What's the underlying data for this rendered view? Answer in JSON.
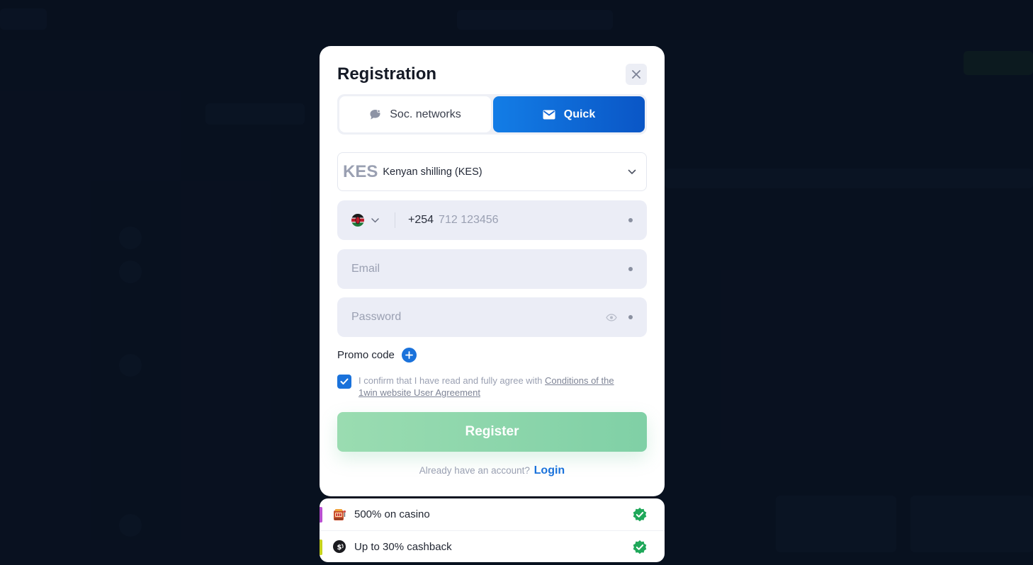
{
  "modal": {
    "title": "Registration",
    "tabs": [
      {
        "label": "Soc. networks",
        "icon": "chat-bubble-icon",
        "active": false
      },
      {
        "label": "Quick",
        "icon": "envelope-icon",
        "active": true
      }
    ],
    "currency": {
      "code": "KES",
      "name": "Kenyan shilling (KES)"
    },
    "phone": {
      "country_flag": "kenya-flag-icon",
      "prefix": "+254",
      "placeholder": "712 123456"
    },
    "email": {
      "placeholder": "Email"
    },
    "password": {
      "placeholder": "Password"
    },
    "promo_label": "Promo code",
    "agreement": {
      "text": "I confirm that I have read and fully agree with ",
      "link": "Conditions of the 1win website User Agreement",
      "checked": true
    },
    "register_label": "Register",
    "login_prompt": "Already have an account?",
    "login_link": "Login"
  },
  "bonuses": [
    {
      "label": "500% on casino",
      "icon": "slot-machine-icon",
      "accent": "#b84fd0"
    },
    {
      "label": "Up to 30% cashback",
      "icon": "cashback-coin-icon",
      "accent": "#c6d21a"
    }
  ],
  "colors": {
    "accent": "#1a72db",
    "register": "#8cd6ad",
    "check": "#1fa85a"
  }
}
